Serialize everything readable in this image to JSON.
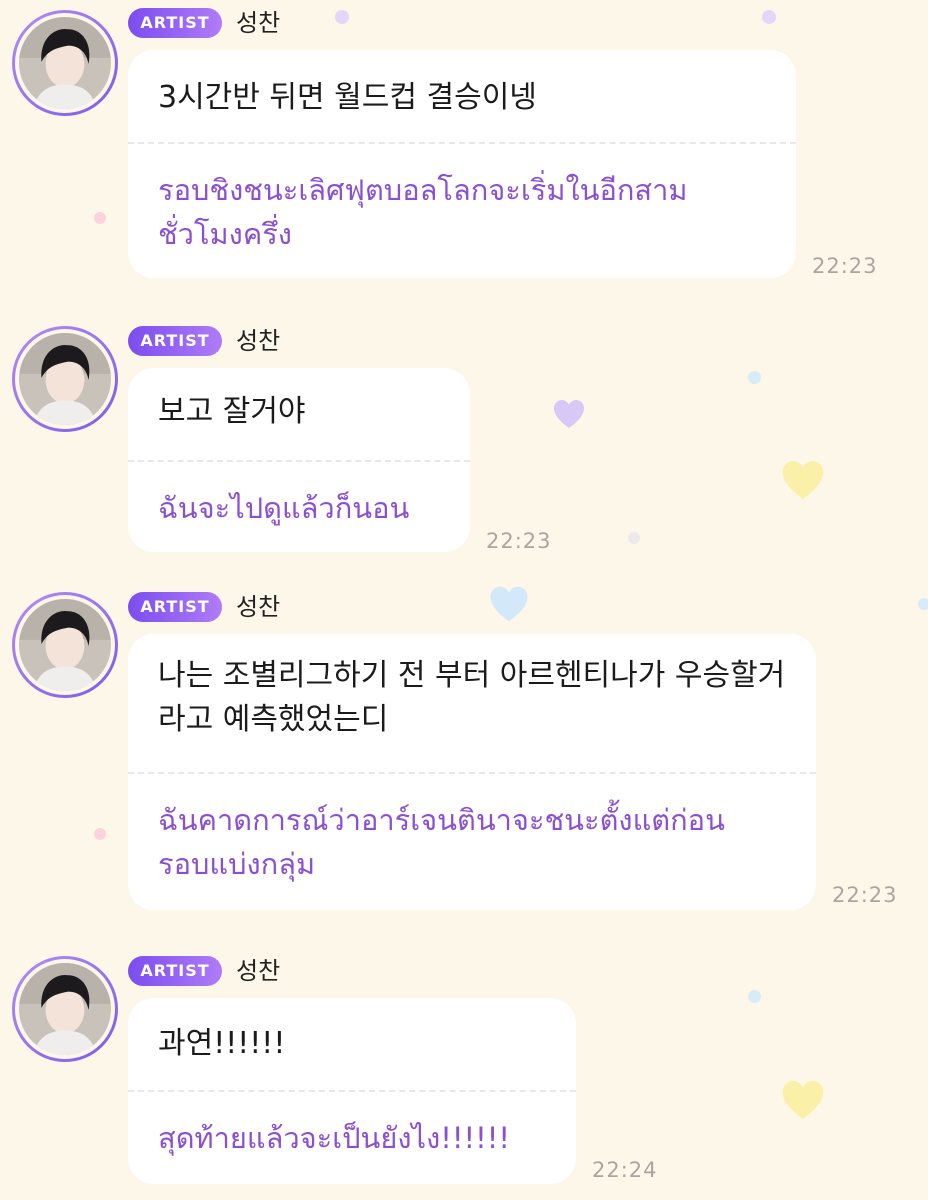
{
  "colors": {
    "background": "#fdf7ea",
    "badge_gradient_start": "#7b4df0",
    "badge_gradient_end": "#b07cf7",
    "translation_text": "#8a4fd3",
    "time_text": "#a9a6a2"
  },
  "messages": [
    {
      "badge": "ARTIST",
      "sender": "성찬",
      "korean": "3시간반 뒤면 월드컵 결승이넹",
      "thai": "รอบชิงชนะเลิศฟุตบอลโลกจะเริ่มในอีกสามชั่วโมงครึ่ง",
      "time": "22:23"
    },
    {
      "badge": "ARTIST",
      "sender": "성찬",
      "korean": "보고 잘거야",
      "thai": "ฉันจะไปดูแล้วก็นอน",
      "time": "22:23"
    },
    {
      "badge": "ARTIST",
      "sender": "성찬",
      "korean": "나는 조별리그하기 전 부터 아르헨티나가 우승할거라고 예측했었는디",
      "thai": "ฉันคาดการณ์ว่าอาร์เจนตินาจะชนะตั้งแต่ก่อนรอบแบ่งกลุ่ม",
      "time": "22:23"
    },
    {
      "badge": "ARTIST",
      "sender": "성찬",
      "korean": "과연!!!!!!",
      "thai": "สุดท้ายแล้วจะเป็นยังไง!!!!!!",
      "time": "22:24"
    }
  ]
}
